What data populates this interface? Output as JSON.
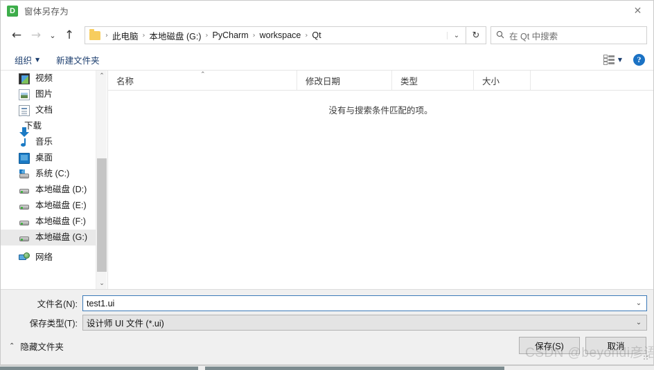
{
  "window": {
    "title": "窗体另存为",
    "app_icon_letter": "D",
    "app_icon_color": "#3dae4a",
    "close_label": "✕"
  },
  "nav": {
    "back_label": "←",
    "forward_label": "→",
    "recent_label": "⌄",
    "up_label": "↑",
    "refresh_label": "↻",
    "breadcrumb_caret": "⌄",
    "breadcrumbs": [
      "此电脑",
      "本地磁盘 (G:)",
      "PyCharm",
      "workspace",
      "Qt"
    ],
    "separator": "›",
    "folder_icon": "folder-icon"
  },
  "search": {
    "icon": "search-icon",
    "placeholder": "在 Qt 中搜索",
    "value": ""
  },
  "toolbar": {
    "organize_label": "组织",
    "organize_caret": "▼",
    "new_folder_label": "新建文件夹",
    "view_icon": "view-options-icon",
    "view_caret": "▼",
    "help_label": "?"
  },
  "sidebar": {
    "scroll_up": "⌃",
    "scroll_down": "⌄",
    "items": [
      {
        "label": "视频",
        "icon": "video-icon",
        "selected": false
      },
      {
        "label": "图片",
        "icon": "picture-icon",
        "selected": false
      },
      {
        "label": "文档",
        "icon": "document-icon",
        "selected": false
      },
      {
        "label": "下载",
        "icon": "download-icon",
        "selected": false
      },
      {
        "label": "音乐",
        "icon": "music-icon",
        "selected": false
      },
      {
        "label": "桌面",
        "icon": "desktop-icon",
        "selected": false
      },
      {
        "label": "系统 (C:)",
        "icon": "system-drive-icon",
        "selected": false
      },
      {
        "label": "本地磁盘 (D:)",
        "icon": "drive-icon",
        "selected": false
      },
      {
        "label": "本地磁盘 (E:)",
        "icon": "drive-icon",
        "selected": false
      },
      {
        "label": "本地磁盘 (F:)",
        "icon": "drive-icon",
        "selected": false
      },
      {
        "label": "本地磁盘 (G:)",
        "icon": "drive-icon",
        "selected": true
      },
      {
        "label": "网络",
        "icon": "network-icon",
        "selected": false
      }
    ]
  },
  "filelist": {
    "columns": [
      {
        "key": "name",
        "label": "名称",
        "sorted": true,
        "sort_caret": "⌃"
      },
      {
        "key": "date",
        "label": "修改日期",
        "sorted": false
      },
      {
        "key": "type",
        "label": "类型",
        "sorted": false
      },
      {
        "key": "size",
        "label": "大小",
        "sorted": false
      }
    ],
    "rows": [],
    "empty_message": "没有与搜索条件匹配的项。"
  },
  "form": {
    "filename_label": "文件名(N):",
    "filename_value": "test1.ui",
    "filename_caret": "⌄",
    "filetype_label": "保存类型(T):",
    "filetype_value": "设计师 UI 文件 (*.ui)",
    "filetype_caret": "⌄"
  },
  "footer": {
    "hide_folders_label": "隐藏文件夹",
    "hide_folders_caret": "⌃",
    "save_label": "保存(S)",
    "cancel_label": "取消"
  },
  "watermark": {
    "text": "CSDN @beyondi彦语"
  },
  "colors": {
    "accent_blue": "#1b72c4",
    "focus_border": "#3a79b8",
    "selection_bg": "#e9e9e9",
    "panel_bg": "#f0f0f0",
    "folder_yellow": "#f7cd5e"
  }
}
